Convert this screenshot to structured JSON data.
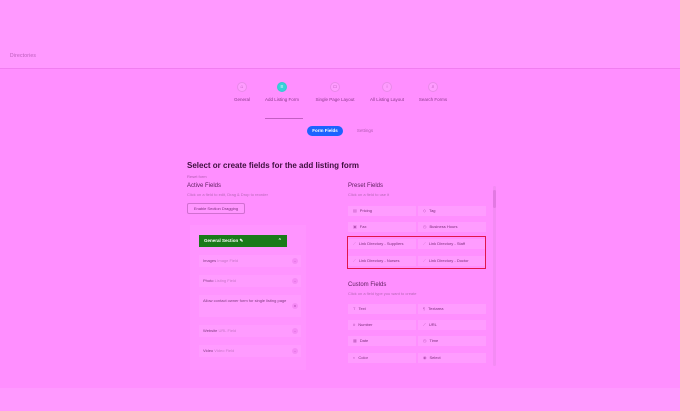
{
  "breadcrumb": "Directories",
  "steps": [
    {
      "label": "General",
      "icon": "home-icon",
      "glyph": "⌂"
    },
    {
      "label": "Add Listing Form",
      "icon": "list-icon",
      "glyph": "≡"
    },
    {
      "label": "Single Page Layout",
      "icon": "page-icon",
      "glyph": "▭"
    },
    {
      "label": "All Listing Layout",
      "icon": "grid-icon",
      "glyph": "⁝"
    },
    {
      "label": "Search Forms",
      "icon": "search-icon",
      "glyph": "⌕"
    }
  ],
  "subtabs": {
    "fields": "Form Fields",
    "settings": "Settings"
  },
  "title": "Select or create fields for the add listing form",
  "reset": "Reset form",
  "active_fields": {
    "title": "Active Fields",
    "sub": "Click on a field to edit, Drag & Drop to reorder",
    "enable_button": "Enable Section Dragging",
    "section": "General Section",
    "items": [
      {
        "label": "Images",
        "sub": "Image Field"
      },
      {
        "label": "Photo",
        "sub": "Listing Field"
      },
      {
        "label": "Allow contact owner form for single listing page",
        "sub": ""
      },
      {
        "label": "Website",
        "sub": "URL Field"
      },
      {
        "label": "Video",
        "sub": "Video Field"
      }
    ]
  },
  "preset_fields": {
    "title": "Preset Fields",
    "sub": "Click on a field to use it",
    "items": [
      {
        "label": "Pricing",
        "icon": "pricing-icon",
        "glyph": "▤"
      },
      {
        "label": "Tag",
        "icon": "tag-icon",
        "glyph": "◇"
      },
      {
        "label": "Fax",
        "icon": "fax-icon",
        "glyph": "▣"
      },
      {
        "label": "Business Hours",
        "icon": "clock-icon",
        "glyph": "◷"
      },
      {
        "label": "Link Directory - Suppliers",
        "icon": "link-icon",
        "glyph": "⟋"
      },
      {
        "label": "Link Directory - Staff",
        "icon": "link-icon",
        "glyph": "⟋"
      },
      {
        "label": "Link Directory - Nurses",
        "icon": "link-icon",
        "glyph": "⟋"
      },
      {
        "label": "Link Directory - Doctor",
        "icon": "link-icon",
        "glyph": "⟋"
      }
    ]
  },
  "custom_fields": {
    "title": "Custom Fields",
    "sub": "Click on a field type you want to create",
    "items": [
      {
        "label": "Text",
        "icon": "text-icon",
        "glyph": "T"
      },
      {
        "label": "Textarea",
        "icon": "textarea-icon",
        "glyph": "¶"
      },
      {
        "label": "Number",
        "icon": "number-icon",
        "glyph": "#"
      },
      {
        "label": "URL",
        "icon": "url-icon",
        "glyph": "⟋"
      },
      {
        "label": "Date",
        "icon": "date-icon",
        "glyph": "▦"
      },
      {
        "label": "Time",
        "icon": "time-icon",
        "glyph": "◷"
      },
      {
        "label": "Color",
        "icon": "color-icon",
        "glyph": "◐"
      },
      {
        "label": "Select",
        "icon": "select-icon",
        "glyph": "◉"
      }
    ]
  }
}
